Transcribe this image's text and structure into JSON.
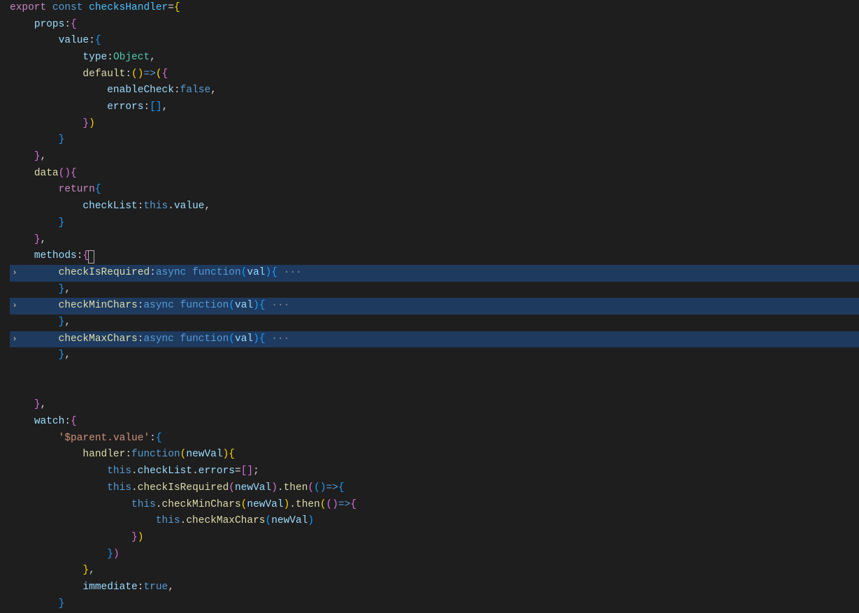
{
  "code": {
    "l1": {
      "kw_export": "export ",
      "kw_const": "const ",
      "name": "checksHandler",
      "eq": "=",
      "brace": "{"
    },
    "l2": {
      "indent": "    ",
      "prop": "props",
      "colon": ":",
      "brace": "{"
    },
    "l3": {
      "indent": "        ",
      "prop": "value",
      "colon": ":",
      "brace": "{"
    },
    "l4": {
      "indent": "            ",
      "prop": "type",
      "colon": ":",
      "val": "Object",
      "comma": ","
    },
    "l5": {
      "indent": "            ",
      "prop": "default",
      "colon": ":",
      "lp": "(",
      "rp": ")",
      "arrow": "=>",
      "lp2": "(",
      "brace": "{"
    },
    "l6": {
      "indent": "                ",
      "prop": "enableCheck",
      "colon": ":",
      "val": "false",
      "comma": ","
    },
    "l7": {
      "indent": "                ",
      "prop": "errors",
      "colon": ":",
      "lb": "[",
      "rb": "]",
      "comma": ","
    },
    "l8": {
      "indent": "            ",
      "rbrace": "}",
      "rp": ")"
    },
    "l9": {
      "indent": "        ",
      "rbrace": "}"
    },
    "l10": {
      "indent": "    ",
      "rbrace": "}",
      "comma": ","
    },
    "l11": {
      "indent": "    ",
      "fn": "data",
      "lp": "(",
      "rp": ")",
      "brace": "{"
    },
    "l12": {
      "indent": "        ",
      "kw": "return",
      "brace": "{"
    },
    "l13": {
      "indent": "            ",
      "prop": "checkList",
      "colon": ":",
      "this": "this",
      "dot": ".",
      "val": "value",
      "comma": ","
    },
    "l14": {
      "indent": "        ",
      "rbrace": "}"
    },
    "l15": {
      "indent": "    ",
      "rbrace": "}",
      "comma": ","
    },
    "l16": {
      "indent": "    ",
      "prop": "methods",
      "colon": ":",
      "brace": "{"
    },
    "l17": {
      "indent": "        ",
      "fn": "checkIsRequired",
      "colon": ":",
      "async": "async ",
      "kw_fn": "function",
      "lp": "(",
      "arg": "val",
      "rp": ")",
      "brace": "{",
      "dots": " ···"
    },
    "l18": {
      "indent": "        ",
      "rbrace": "}",
      "comma": ","
    },
    "l19": {
      "indent": "        ",
      "fn": "checkMinChars",
      "colon": ":",
      "async": "async ",
      "kw_fn": "function",
      "lp": "(",
      "arg": "val",
      "rp": ")",
      "brace": "{",
      "dots": " ···"
    },
    "l20": {
      "indent": "        ",
      "rbrace": "}",
      "comma": ","
    },
    "l21": {
      "indent": "        ",
      "fn": "checkMaxChars",
      "colon": ":",
      "async": "async ",
      "kw_fn": "function",
      "lp": "(",
      "arg": "val",
      "rp": ")",
      "brace": "{",
      "dots": " ···"
    },
    "l22": {
      "indent": "        ",
      "rbrace": "}",
      "comma": ","
    },
    "l23": "",
    "l24": "",
    "l25": {
      "indent": "    ",
      "rbrace": "}",
      "comma": ","
    },
    "l26": {
      "indent": "    ",
      "prop": "watch",
      "colon": ":",
      "brace": "{"
    },
    "l27": {
      "indent": "        ",
      "str": "'$parent.value'",
      "colon": ":",
      "brace": "{"
    },
    "l28": {
      "indent": "            ",
      "fn": "handler",
      "colon": ":",
      "kw_fn": "function",
      "lp": "(",
      "arg": "newVal",
      "rp": ")",
      "brace": "{"
    },
    "l29": {
      "indent": "                ",
      "this": "this",
      "dot": ".",
      "prop1": "checkList",
      "dot2": ".",
      "prop2": "errors",
      "eq": "=",
      "lb": "[",
      "rb": "]",
      "semi": ";"
    },
    "l30": {
      "indent": "                ",
      "this": "this",
      "dot": ".",
      "fn": "checkIsRequired",
      "lp": "(",
      "arg": "newVal",
      "rp": ")",
      "dot2": ".",
      "then": "then",
      "lp2": "(",
      "lp3": "(",
      "rp3": ")",
      "arrow": "=>",
      "brace": "{"
    },
    "l31": {
      "indent": "                    ",
      "this": "this",
      "dot": ".",
      "fn": "checkMinChars",
      "lp": "(",
      "arg": "newVal",
      "rp": ")",
      "dot2": ".",
      "then": "then",
      "lp2": "(",
      "lp3": "(",
      "rp3": ")",
      "arrow": "=>",
      "brace": "{"
    },
    "l32": {
      "indent": "                        ",
      "this": "this",
      "dot": ".",
      "fn": "checkMaxChars",
      "lp": "(",
      "arg": "newVal",
      "rp": ")"
    },
    "l33": {
      "indent": "                    ",
      "rbrace": "}",
      "rp": ")"
    },
    "l34": {
      "indent": "                ",
      "rbrace": "}",
      "rp": ")"
    },
    "l35": {
      "indent": "            ",
      "rbrace": "}",
      "comma": ","
    },
    "l36": {
      "indent": "            ",
      "prop": "immediate",
      "colon": ":",
      "val": "true",
      "comma": ","
    },
    "l37": {
      "indent": "        ",
      "rbrace": "}"
    }
  },
  "fold_arrow": "›"
}
